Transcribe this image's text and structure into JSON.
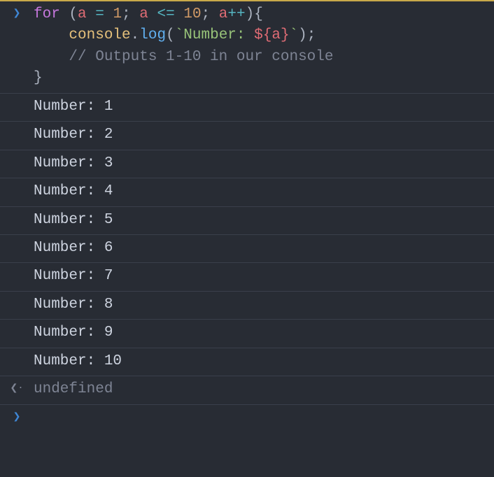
{
  "input": {
    "line1": {
      "kw_for": "for",
      "sp1": " ",
      "paren_open": "(",
      "id_a1": "a",
      "sp2": " ",
      "op_eq": "=",
      "sp3": " ",
      "num_1": "1",
      "semi1": ";",
      "sp4": " ",
      "id_a2": "a",
      "sp5": " ",
      "op_le": "<=",
      "sp6": " ",
      "num_10": "10",
      "semi2": ";",
      "sp7": " ",
      "id_a3": "a",
      "op_inc": "++",
      "paren_close": ")",
      "brace_open": "{"
    },
    "line2": {
      "indent": "    ",
      "obj": "console",
      "dot": ".",
      "fn": "log",
      "paren_open": "(",
      "bt1": "`",
      "str": "Number: ",
      "tmpl_open": "${",
      "id_a": "a",
      "tmpl_close": "}",
      "bt2": "`",
      "paren_close": ")",
      "semi": ";"
    },
    "line3": {
      "indent": "    ",
      "comment": "// Outputs 1-10 in our console"
    },
    "line4": {
      "brace_close": "}"
    }
  },
  "outputs": [
    "Number: 1",
    "Number: 2",
    "Number: 3",
    "Number: 4",
    "Number: 5",
    "Number: 6",
    "Number: 7",
    "Number: 8",
    "Number: 9",
    "Number: 10"
  ],
  "return_value": "undefined"
}
